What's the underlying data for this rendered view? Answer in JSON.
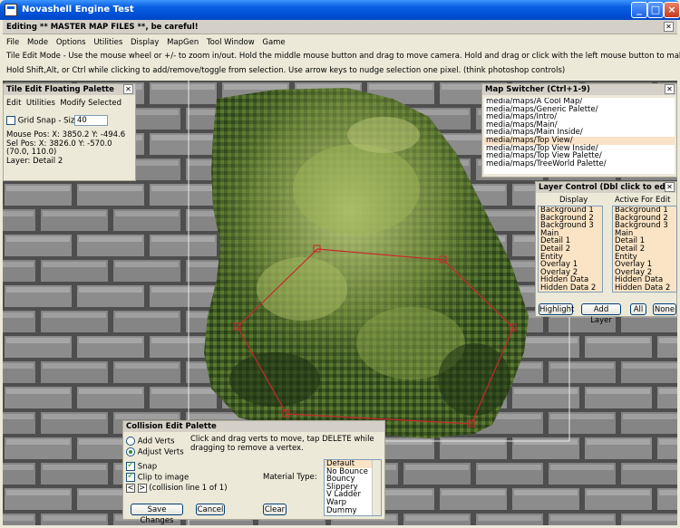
{
  "window": {
    "title": "Novashell Engine Test"
  },
  "editor": {
    "banner": "Editing ** MASTER MAP FILES **, be careful!",
    "menu": [
      "File",
      "Mode",
      "Options",
      "Utilities",
      "Display",
      "MapGen",
      "Tool Window",
      "Game"
    ],
    "help_line1": "Tile Edit Mode - Use the mouse wheel or +/- to zoom in/out.  Hold the middle mouse button and drag to move camera.  Hold and drag or click with the left mouse button to make a selection.",
    "help_line2": "Hold Shift,Alt, or Ctrl while clicking to add/remove/toggle from selection.  Use arrow keys to nudge selection one pixel.  (think photoshop controls)"
  },
  "tile_palette": {
    "title": "Tile Edit Floating Palette",
    "menu": [
      "Edit",
      "Utilities",
      "Modify Selected"
    ],
    "grid_snap_label": "Grid Snap - Size",
    "grid_snap_value": "40",
    "mouse_pos": "Mouse Pos: X: 3850.2 Y: -494.6",
    "sel_pos": "Sel Pos: X: 3826.0 Y: -570.0",
    "sel_size": "(70.0, 110.0)",
    "layer": "Layer: Detail 2"
  },
  "map_switcher": {
    "title": "Map Switcher (Ctrl+1-9)",
    "items": [
      "media/maps/A Cool Map/",
      "media/maps/Generic Palette/",
      "media/maps/Intro/",
      "media/maps/Main/",
      "media/maps/Main Inside/",
      "media/maps/Top View/",
      "media/maps/Top View Inside/",
      "media/maps/Top View Palette/",
      "media/maps/TreeWorld Palette/"
    ],
    "selected_index": 5
  },
  "layer_control": {
    "title": "Layer Control (Dbl click to edit)",
    "display_header": "Display",
    "active_header": "Active For Edit",
    "layers": [
      "Background 1",
      "Background 2",
      "Background 3",
      "Main",
      "Detail 1",
      "Detail 2",
      "Entity",
      "Overlay 1",
      "Overlay 2",
      "Hidden Data",
      "Hidden Data 2"
    ],
    "buttons": [
      "Highlight",
      "Add Layer",
      "All",
      "None"
    ]
  },
  "collision_palette": {
    "title": "Collision Edit Palette",
    "radio_add": "Add Verts",
    "radio_adjust": "Adjust Verts",
    "hint": "Click and drag verts to move, tap DELETE while dragging to remove a vertex.",
    "snap_label": "Snap",
    "clip_label": "Clip to image",
    "prev_label": "<",
    "next_label": ">",
    "collision_line": "(collision line 1 of 1)",
    "material_label": "Material Type:",
    "materials": [
      "Default",
      "No Bounce",
      "Bouncy",
      "Slippery",
      "V Ladder",
      "Warp",
      "Dummy"
    ],
    "save_label": "Save Changes",
    "cancel_label": "Cancel",
    "clear_label": "Clear"
  },
  "colors": {
    "titlebar": "#0A5FE0",
    "selection_outline": "#C8282A",
    "foliage_light": "#B8C878",
    "foliage_dark": "#1E3214",
    "stone": "#8A8A8A"
  }
}
